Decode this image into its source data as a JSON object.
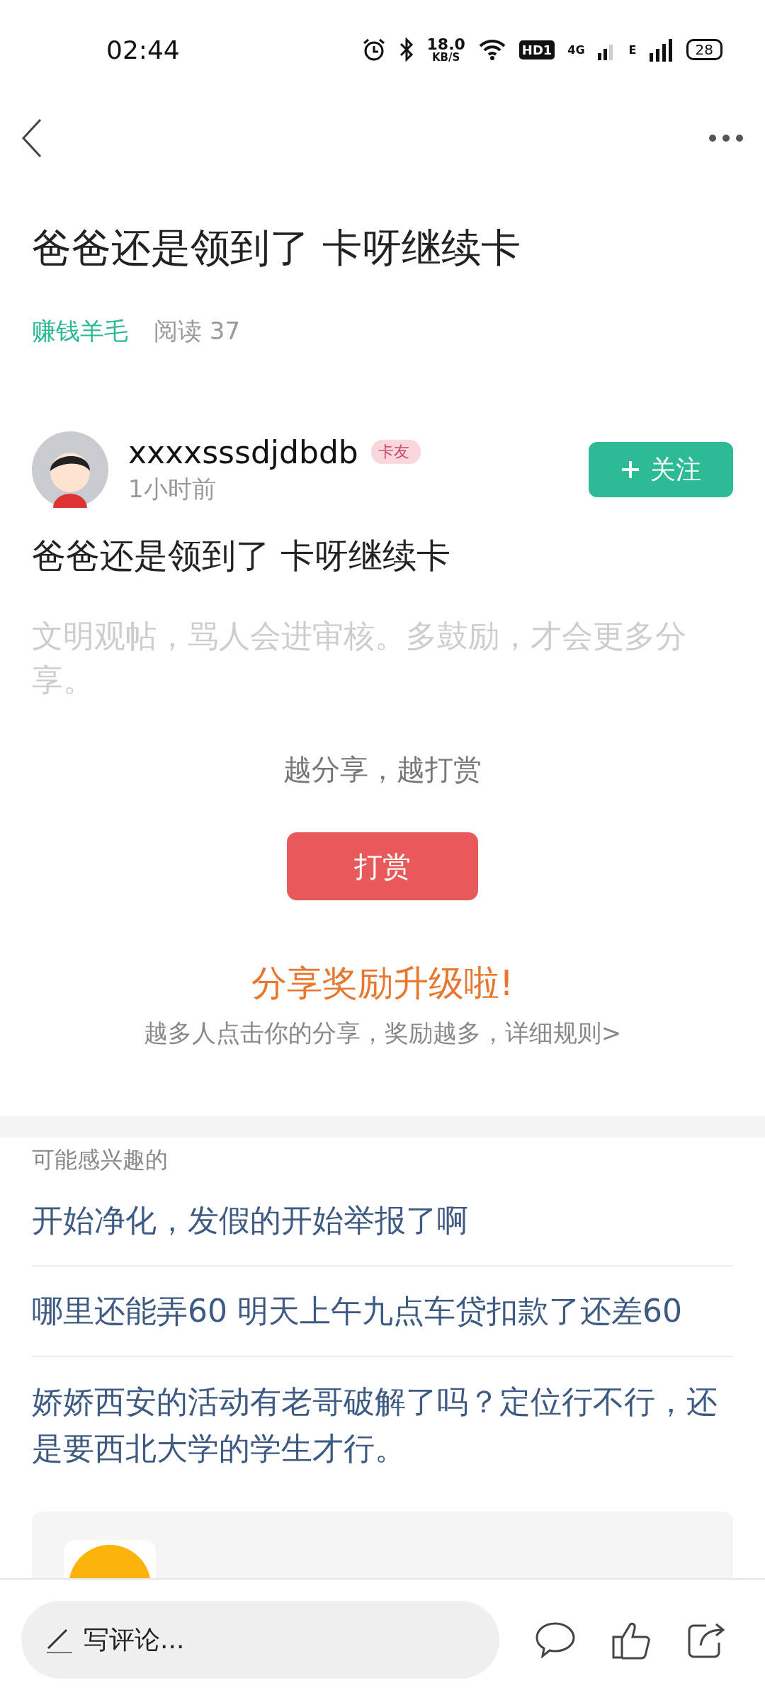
{
  "status_bar": {
    "time": "02:44",
    "speed_value": "18.0",
    "speed_unit": "KB/S",
    "hd_label": "HD1",
    "network_label": "4G",
    "edge_label": "E",
    "battery": "28"
  },
  "post": {
    "title": "爸爸还是领到了 卡呀继续卡",
    "category": "赚钱羊毛",
    "reads": "阅读 37",
    "author": {
      "name": "xxxxsssdjdbdb",
      "badge": "卡友",
      "time": "1小时前"
    },
    "follow_label": "关注",
    "body": "爸爸还是领到了 卡呀继续卡",
    "notice": "文明观帖，骂人会进审核。多鼓励，才会更多分享。",
    "reward_hint": "越分享，越打赏",
    "reward_button": "打赏",
    "share_title": "分享奖励升级啦!",
    "share_text": "越多人点击你的分享，奖励越多，详细规则>"
  },
  "related": {
    "heading": "可能感兴趣的",
    "items": [
      {
        "title": "开始净化，发假的开始举报了啊"
      },
      {
        "title": "哪里还能弄60 明天上午九点车贷扣款了还差60"
      },
      {
        "title": "娇娇西安的活动有老哥破解了吗？定位行不行，还是要西北大学的学生才行。"
      }
    ]
  },
  "bottom_bar": {
    "comment_placeholder": "写评论..."
  }
}
